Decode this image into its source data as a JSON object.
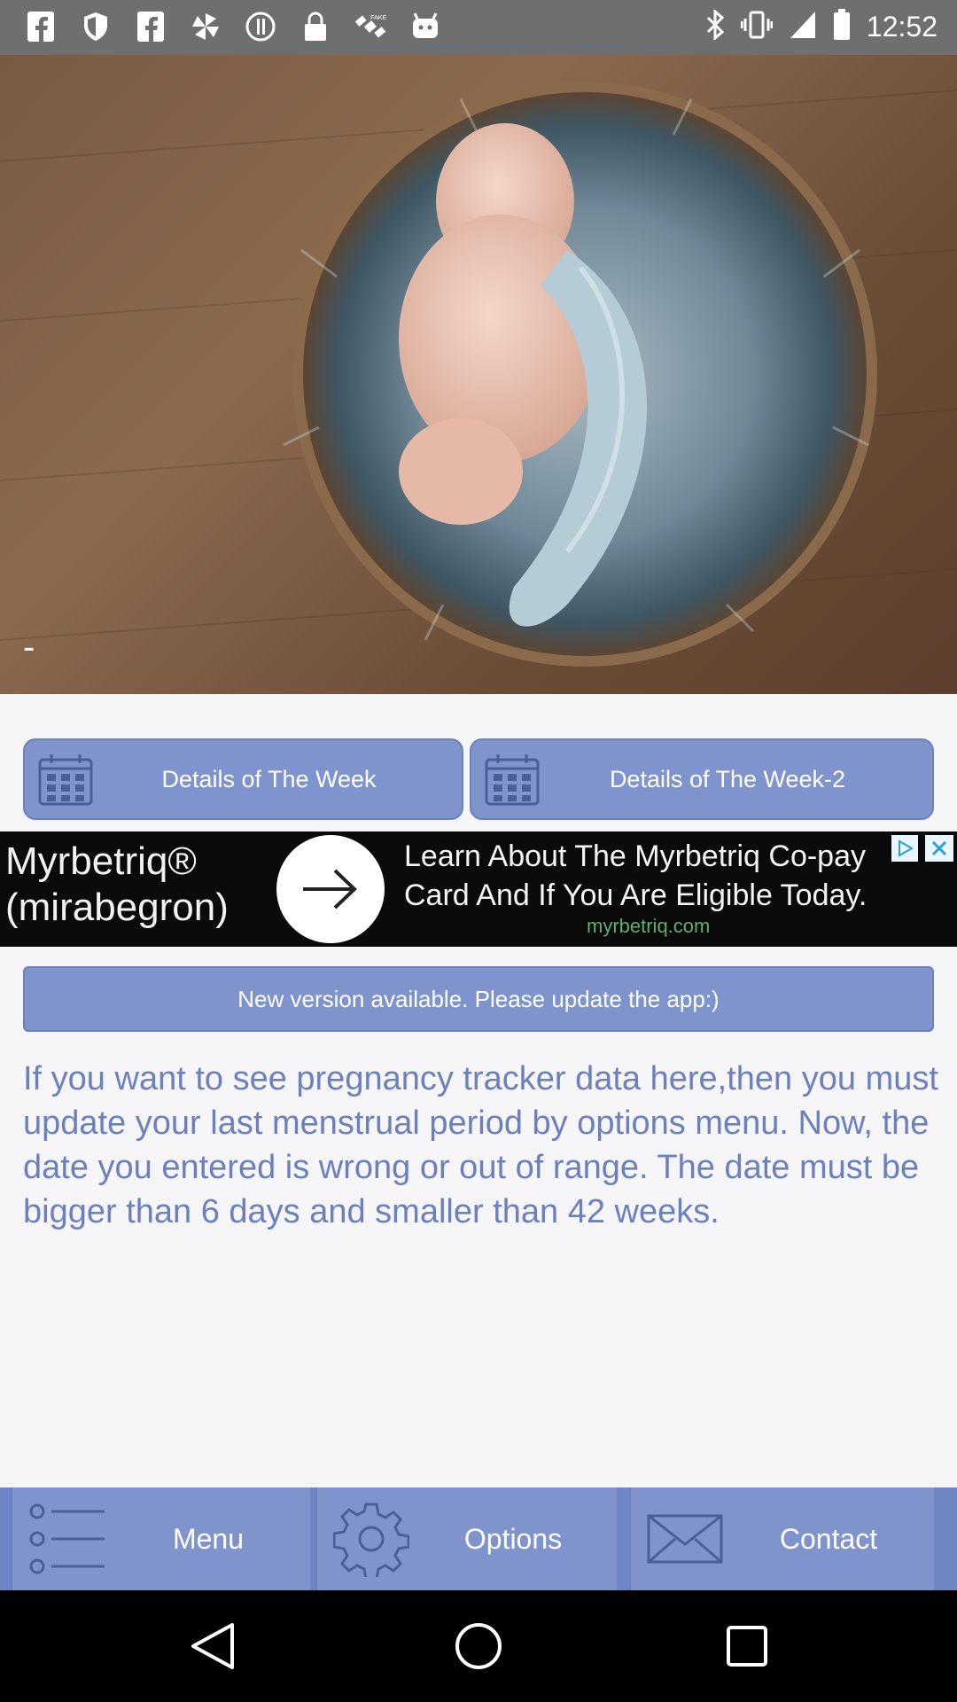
{
  "status_bar": {
    "time": "12:52",
    "icons": [
      "facebook-icon",
      "shield-icon",
      "facebook-icon",
      "pinwheel-icon",
      "info-circle-icon",
      "lock-icon",
      "satellite-icon",
      "android-icon"
    ],
    "right_icons": [
      "bluetooth-icon",
      "vibrate-icon",
      "signal-icon",
      "battery-icon"
    ]
  },
  "hero": {
    "caption": "-"
  },
  "week_buttons": {
    "week_label": "Details of The Week",
    "week2_label": "Details of The Week-2"
  },
  "ad": {
    "brand_line1": "Myrbetriq®",
    "brand_line2": "(mirabegron)",
    "text_line1": "Learn About The Myrbetriq Co-pay",
    "text_line2": "Card And If You Are Eligible Today.",
    "url": "myrbetriq.com"
  },
  "update_notice": "New version available. Please update the app:)",
  "info_text": "If you want to see pregnancy tracker data here,then you must update your last menstrual period by options menu. Now, the date you entered is wrong or out of range. The date must be bigger than 6 days and smaller than 42 weeks.",
  "bottom_nav": {
    "menu": "Menu",
    "options": "Options",
    "contact": "Contact"
  },
  "colors": {
    "button_fill": "#7f94cc",
    "button_border": "#6b80bd",
    "text_accent": "#6b80bd",
    "status_bar": "#6f6f6f"
  }
}
